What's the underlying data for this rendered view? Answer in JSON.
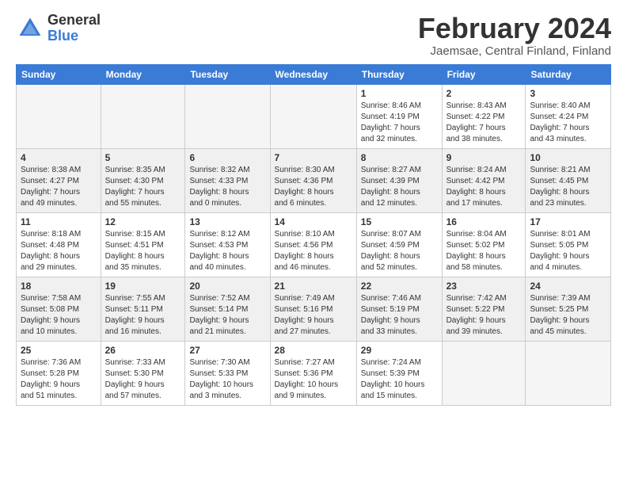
{
  "header": {
    "logo_general": "General",
    "logo_blue": "Blue",
    "title": "February 2024",
    "location": "Jaemsae, Central Finland, Finland"
  },
  "days_of_week": [
    "Sunday",
    "Monday",
    "Tuesday",
    "Wednesday",
    "Thursday",
    "Friday",
    "Saturday"
  ],
  "weeks": [
    [
      {
        "day": "",
        "info": "",
        "empty": true
      },
      {
        "day": "",
        "info": "",
        "empty": true
      },
      {
        "day": "",
        "info": "",
        "empty": true
      },
      {
        "day": "",
        "info": "",
        "empty": true
      },
      {
        "day": "1",
        "info": "Sunrise: 8:46 AM\nSunset: 4:19 PM\nDaylight: 7 hours\nand 32 minutes."
      },
      {
        "day": "2",
        "info": "Sunrise: 8:43 AM\nSunset: 4:22 PM\nDaylight: 7 hours\nand 38 minutes."
      },
      {
        "day": "3",
        "info": "Sunrise: 8:40 AM\nSunset: 4:24 PM\nDaylight: 7 hours\nand 43 minutes."
      }
    ],
    [
      {
        "day": "4",
        "info": "Sunrise: 8:38 AM\nSunset: 4:27 PM\nDaylight: 7 hours\nand 49 minutes."
      },
      {
        "day": "5",
        "info": "Sunrise: 8:35 AM\nSunset: 4:30 PM\nDaylight: 7 hours\nand 55 minutes."
      },
      {
        "day": "6",
        "info": "Sunrise: 8:32 AM\nSunset: 4:33 PM\nDaylight: 8 hours\nand 0 minutes."
      },
      {
        "day": "7",
        "info": "Sunrise: 8:30 AM\nSunset: 4:36 PM\nDaylight: 8 hours\nand 6 minutes."
      },
      {
        "day": "8",
        "info": "Sunrise: 8:27 AM\nSunset: 4:39 PM\nDaylight: 8 hours\nand 12 minutes."
      },
      {
        "day": "9",
        "info": "Sunrise: 8:24 AM\nSunset: 4:42 PM\nDaylight: 8 hours\nand 17 minutes."
      },
      {
        "day": "10",
        "info": "Sunrise: 8:21 AM\nSunset: 4:45 PM\nDaylight: 8 hours\nand 23 minutes."
      }
    ],
    [
      {
        "day": "11",
        "info": "Sunrise: 8:18 AM\nSunset: 4:48 PM\nDaylight: 8 hours\nand 29 minutes."
      },
      {
        "day": "12",
        "info": "Sunrise: 8:15 AM\nSunset: 4:51 PM\nDaylight: 8 hours\nand 35 minutes."
      },
      {
        "day": "13",
        "info": "Sunrise: 8:12 AM\nSunset: 4:53 PM\nDaylight: 8 hours\nand 40 minutes."
      },
      {
        "day": "14",
        "info": "Sunrise: 8:10 AM\nSunset: 4:56 PM\nDaylight: 8 hours\nand 46 minutes."
      },
      {
        "day": "15",
        "info": "Sunrise: 8:07 AM\nSunset: 4:59 PM\nDaylight: 8 hours\nand 52 minutes."
      },
      {
        "day": "16",
        "info": "Sunrise: 8:04 AM\nSunset: 5:02 PM\nDaylight: 8 hours\nand 58 minutes."
      },
      {
        "day": "17",
        "info": "Sunrise: 8:01 AM\nSunset: 5:05 PM\nDaylight: 9 hours\nand 4 minutes."
      }
    ],
    [
      {
        "day": "18",
        "info": "Sunrise: 7:58 AM\nSunset: 5:08 PM\nDaylight: 9 hours\nand 10 minutes."
      },
      {
        "day": "19",
        "info": "Sunrise: 7:55 AM\nSunset: 5:11 PM\nDaylight: 9 hours\nand 16 minutes."
      },
      {
        "day": "20",
        "info": "Sunrise: 7:52 AM\nSunset: 5:14 PM\nDaylight: 9 hours\nand 21 minutes."
      },
      {
        "day": "21",
        "info": "Sunrise: 7:49 AM\nSunset: 5:16 PM\nDaylight: 9 hours\nand 27 minutes."
      },
      {
        "day": "22",
        "info": "Sunrise: 7:46 AM\nSunset: 5:19 PM\nDaylight: 9 hours\nand 33 minutes."
      },
      {
        "day": "23",
        "info": "Sunrise: 7:42 AM\nSunset: 5:22 PM\nDaylight: 9 hours\nand 39 minutes."
      },
      {
        "day": "24",
        "info": "Sunrise: 7:39 AM\nSunset: 5:25 PM\nDaylight: 9 hours\nand 45 minutes."
      }
    ],
    [
      {
        "day": "25",
        "info": "Sunrise: 7:36 AM\nSunset: 5:28 PM\nDaylight: 9 hours\nand 51 minutes."
      },
      {
        "day": "26",
        "info": "Sunrise: 7:33 AM\nSunset: 5:30 PM\nDaylight: 9 hours\nand 57 minutes."
      },
      {
        "day": "27",
        "info": "Sunrise: 7:30 AM\nSunset: 5:33 PM\nDaylight: 10 hours\nand 3 minutes."
      },
      {
        "day": "28",
        "info": "Sunrise: 7:27 AM\nSunset: 5:36 PM\nDaylight: 10 hours\nand 9 minutes."
      },
      {
        "day": "29",
        "info": "Sunrise: 7:24 AM\nSunset: 5:39 PM\nDaylight: 10 hours\nand 15 minutes."
      },
      {
        "day": "",
        "info": "",
        "empty": true
      },
      {
        "day": "",
        "info": "",
        "empty": true
      }
    ]
  ]
}
